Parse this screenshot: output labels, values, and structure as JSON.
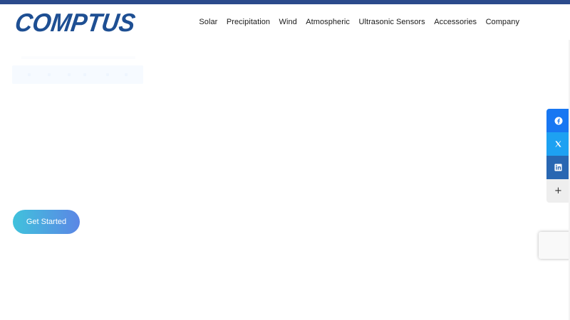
{
  "brand": {
    "logo_text": "COMPTUS",
    "logo_color": "#1e4f93",
    "top_stripe_color": "#2b4b8c"
  },
  "nav": {
    "items": [
      {
        "label": "Solar"
      },
      {
        "label": "Precipitation"
      },
      {
        "label": "Wind"
      },
      {
        "label": "Atmospheric"
      },
      {
        "label": "Ultrasonic Sensors"
      },
      {
        "label": "Accessories"
      },
      {
        "label": "Company"
      }
    ]
  },
  "hero": {
    "cta_label": "Get Started",
    "cta_gradient_start": "#40c2dc",
    "cta_gradient_end": "#5b86e5"
  },
  "share": {
    "items": [
      {
        "icon": "facebook-icon",
        "color": "#1877f2"
      },
      {
        "icon": "x-twitter-icon",
        "color": "#1da1f2"
      },
      {
        "icon": "linkedin-icon",
        "color": "#2867b2"
      },
      {
        "icon": "plus-icon",
        "color": "#eeeeee",
        "glyph": "+"
      }
    ]
  },
  "recaptcha": {
    "icon": "recaptcha-badge-icon"
  }
}
